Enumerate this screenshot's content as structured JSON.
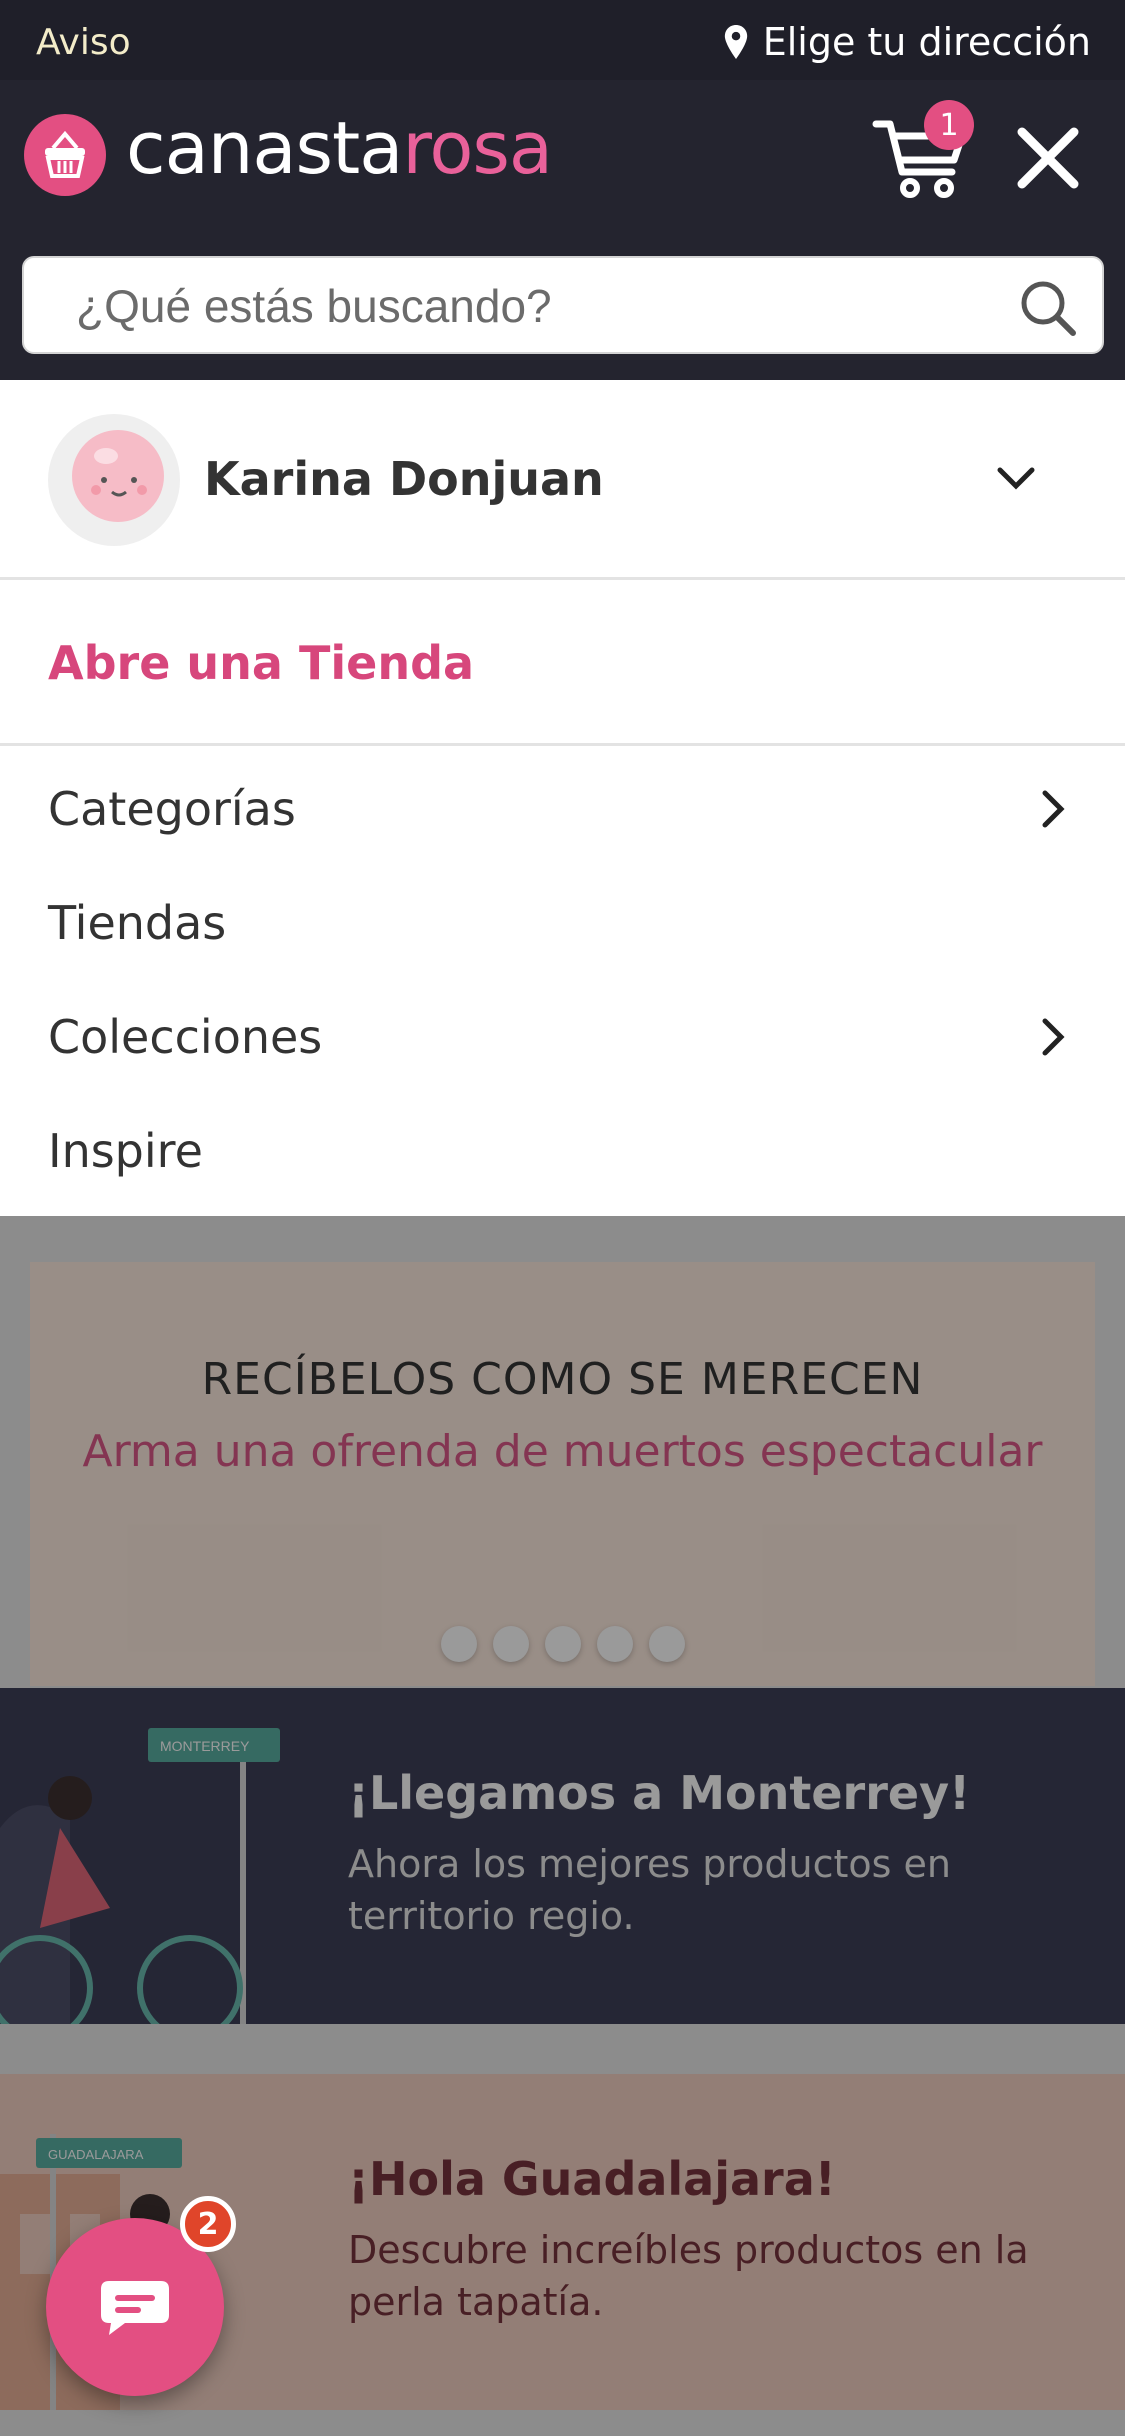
{
  "topbar": {
    "notice": "Aviso",
    "address_label": "Elige tu dirección",
    "pin_icon": "map-pin-icon"
  },
  "header": {
    "logo_part1": "canasta",
    "logo_part2": "rosa",
    "cart_count": "1",
    "cart_icon": "cart-icon",
    "close_icon": "close-icon"
  },
  "search": {
    "placeholder": "¿Qué estás buscando?",
    "icon": "search-icon"
  },
  "menu": {
    "user_name": "Karina Donjuan",
    "open_store": "Abre una Tienda",
    "items": [
      {
        "label": "Categorías",
        "has_submenu": true
      },
      {
        "label": "Tiendas",
        "has_submenu": false
      },
      {
        "label": "Colecciones",
        "has_submenu": true
      },
      {
        "label": "Inspire",
        "has_submenu": false
      }
    ]
  },
  "hero": {
    "title": "RECÍBELOS COMO SE MERECEN",
    "subtitle": "Arma una ofrenda de muertos espectacular",
    "dot_count": 5
  },
  "banners": [
    {
      "title": "¡Llegamos a Monterrey!",
      "description": "Ahora los mejores productos en territorio regio.",
      "sign": "MONTERREY"
    },
    {
      "title": "¡Hola Guadalajara!",
      "description": "Descubre increíbles productos en la perla tapatía.",
      "sign": "GUADALAJARA"
    }
  ],
  "chat": {
    "badge": "2",
    "icon": "chat-icon"
  },
  "colors": {
    "brand_pink": "#e34f82",
    "header_dark": "#24242f"
  }
}
